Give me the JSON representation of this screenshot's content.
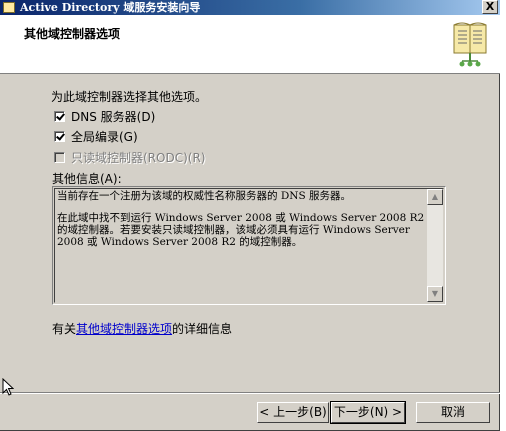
{
  "window": {
    "title": "Active Directory 域服务安装向导",
    "close_label": "X"
  },
  "header": {
    "title": "其他域控制器选项",
    "icon": "book-icon"
  },
  "prompt": "为此域控制器选择其他选项。",
  "options": [
    {
      "label": "DNS 服务器(D)",
      "checked": true,
      "enabled": true
    },
    {
      "label": "全局编录(G)",
      "checked": true,
      "enabled": true
    },
    {
      "label": "只读域控制器(RODC)(R)",
      "checked": false,
      "enabled": false
    }
  ],
  "info": {
    "label": "其他信息(A):",
    "paragraph1": "当前存在一个注册为该域的权威性名称服务器的 DNS 服务器。",
    "paragraph2": "在此域中找不到运行 Windows Server 2008 或 Windows Server 2008 R2 的域控制器。若要安装只读域控制器，该域必须具有运行 Windows Server 2008 或 Windows Server 2008 R2 的域控制器。"
  },
  "more_info": {
    "prefix": "有关",
    "link": "其他域控制器选项",
    "suffix": "的详细信息"
  },
  "buttons": {
    "back": "< 上一步(B)",
    "next": "下一步(N) >",
    "cancel": "取消"
  }
}
